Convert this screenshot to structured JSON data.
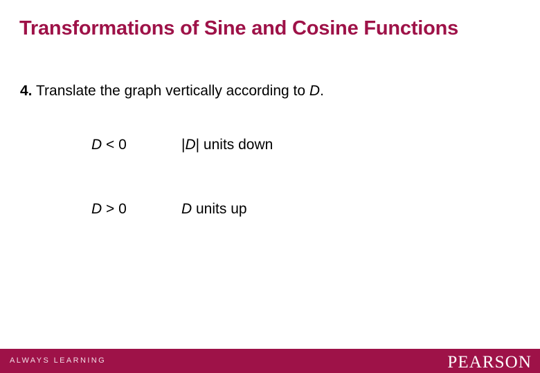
{
  "slide": {
    "title": "Transformations of Sine and Cosine Functions",
    "intro": {
      "number": "4.",
      "text_before": " Translate the graph vertically according to ",
      "variable": "D",
      "text_after": "."
    },
    "rules": [
      {
        "condition_variable": "D",
        "condition_operator": "<",
        "condition_value": "0",
        "condition_full": "D < 0",
        "description_prefix": "|",
        "description_variable": "D",
        "description_suffix": "| units down",
        "description_full": "|D| units down"
      },
      {
        "condition_variable": "D",
        "condition_operator": ">",
        "condition_value": "0",
        "condition_full": "D > 0",
        "description_prefix": "",
        "description_variable": "D",
        "description_suffix": " units up",
        "description_full": "D units up"
      }
    ],
    "footer": {
      "tagline": "ALWAYS LEARNING",
      "logo": "PEARSON"
    },
    "colors": {
      "brand_crimson": "#9e1248",
      "tagline_text": "#f2dce6",
      "logo_text": "#ffffff",
      "body_text": "#000000",
      "background": "#ffffff"
    }
  }
}
